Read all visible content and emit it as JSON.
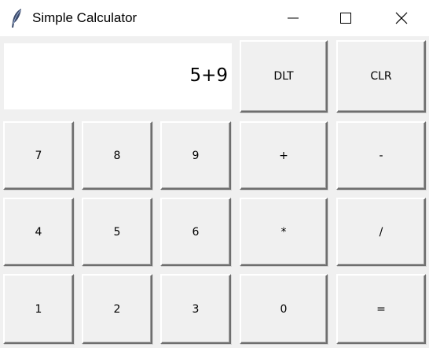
{
  "window": {
    "title": "Simple Calculator",
    "icon": "feather-icon",
    "controls": {
      "minimize": "minimize-icon",
      "maximize": "maximize-icon",
      "close": "close-icon"
    }
  },
  "display": {
    "value": "5+9"
  },
  "buttons": {
    "dlt": "DLT",
    "clr": "CLR",
    "n7": "7",
    "n8": "8",
    "n9": "9",
    "plus": "+",
    "minus": "-",
    "n4": "4",
    "n5": "5",
    "n6": "6",
    "multiply": "*",
    "divide": "/",
    "n1": "1",
    "n2": "2",
    "n3": "3",
    "n0": "0",
    "equals": "="
  }
}
